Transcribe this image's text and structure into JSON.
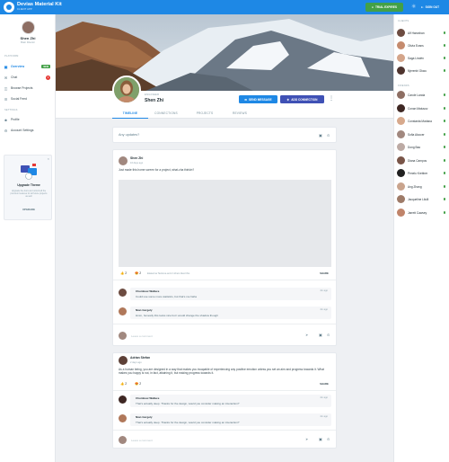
{
  "app": {
    "title": "Devias Material Kit",
    "subtitle": "CLIENT APP"
  },
  "topbar": {
    "trial_label": "TRIAL EXPIRES",
    "signout_label": "SIGN OUT"
  },
  "sidebar": {
    "user": {
      "name": "Shen Zhi",
      "role": "Brain Director"
    },
    "platform_label": "PLATFORM",
    "items": [
      {
        "label": "Overview",
        "icon": "dashboard-icon",
        "badge": "NEW"
      },
      {
        "label": "Chat",
        "icon": "chat-icon",
        "count": "3"
      },
      {
        "label": "Browse Projects",
        "icon": "folder-icon"
      },
      {
        "label": "Social Feed",
        "icon": "feed-icon"
      }
    ],
    "settings_label": "SETTINGS",
    "settings_items": [
      {
        "label": "Profile",
        "icon": "person-icon"
      },
      {
        "label": "Account Settings",
        "icon": "gear-icon"
      }
    ],
    "upgrade": {
      "title": "Upgrade Theme",
      "text": "Upgrade the docs and unlock all the premium features for all future projects as well",
      "button": "UPGRADE"
    }
  },
  "profile": {
    "role": "ENGINEER",
    "name": "Shen Zhi",
    "send_message": "SEND MESSAGE",
    "add_connection": "ADD CONNECTION",
    "tabs": [
      "TIMELINE",
      "CONNECTIONS",
      "PROJECTS",
      "REVIEWS"
    ]
  },
  "update_box": {
    "placeholder": "Any updates?"
  },
  "posts": [
    {
      "author": "Shen Zhi",
      "time": "16 days ago",
      "text": "Just made this home screen for a project, what-cha thinkin?",
      "likes": "2",
      "hearts": "2",
      "reaction_note": "Ekaterina Tankova and 2 others liked this",
      "share": "SHARE",
      "comments": [
        {
          "name": "Chumbow Wallace",
          "time": "4m ago",
          "text": "Could use some more statistics, but that's me haha"
        },
        {
          "name": "Nian Gergely",
          "time": "4m ago",
          "text": "Hmm, honestly this looks nice but I would change the shadow though"
        }
      ],
      "reply_placeholder": "Leave a comment"
    },
    {
      "author": "Adrian Stefan",
      "time": "2 days ago",
      "text": "As a human being, you are designed in a way that makes you incapable of experiencing any positive emotion unless you set an aim and progress towards it. What makes you happy is not, in fact, attaining it, but making progress towards it.",
      "likes": "2",
      "hearts": "2",
      "share": "SHARE",
      "comments": [
        {
          "name": "Chumbow Wallace",
          "time": "4m ago",
          "text": "That's actually deep. Thanks for the design, would you consider making an interaction?"
        },
        {
          "name": "Nian Gergely",
          "time": "4m ago",
          "text": "That's actually deep. Thanks for the design, would you consider making an interaction?"
        }
      ],
      "reply_placeholder": "Leave a comment"
    }
  ],
  "rightbar": {
    "clients_label": "CLIENTS",
    "clients": [
      "Alf Hanrahan",
      "Olivia Evans",
      "Saga Lindén",
      "Njerenhi Okwu"
    ],
    "friends_label": "FRIENDS",
    "friends": [
      "Carole Landa",
      "Conan Matusov",
      "Constanta Mariana",
      "Sofia Alcocer",
      "Dong Bao",
      "Diana Campos",
      "Penelo Krebber",
      "Ang Zhang",
      "Jacqueline Lilulli",
      "Jarrett Cawsey"
    ]
  },
  "colors": {
    "primary": "#1e88e5",
    "secondary": "#3f51b5",
    "success": "#43a047",
    "danger": "#e53935"
  }
}
